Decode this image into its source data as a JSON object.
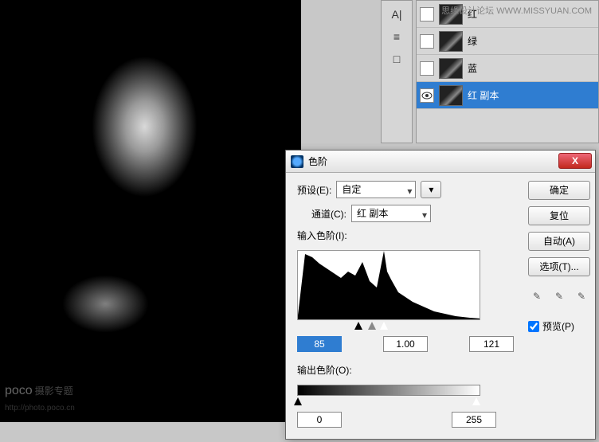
{
  "watermark": {
    "brand": "poco",
    "tag": "摄影专题",
    "url": "http://photo.poco.cn",
    "top": "思缘设计论坛   WWW.MISSYUAN.COM"
  },
  "sidebar": {
    "type_icon": "A|",
    "align_icon": "≡",
    "swatch_icon": "□"
  },
  "channels": {
    "items": [
      {
        "vis": "",
        "name": "红"
      },
      {
        "vis": "",
        "name": "绿"
      },
      {
        "vis": "",
        "name": "蓝"
      },
      {
        "vis": "eye",
        "name": "红 副本",
        "selected": true
      }
    ]
  },
  "dialog": {
    "title": "色阶",
    "preset_label": "预设(E):",
    "preset_value": "自定",
    "channel_label": "通道(C):",
    "channel_value": "红 副本",
    "input_label": "输入色阶(I):",
    "output_label": "输出色阶(O):",
    "input_vals": {
      "black": "85",
      "gamma": "1.00",
      "white": "121"
    },
    "output_vals": {
      "black": "0",
      "white": "255"
    },
    "buttons": {
      "ok": "确定",
      "cancel": "复位",
      "auto": "自动(A)",
      "options": "选项(T)..."
    },
    "preview": "预览(P)",
    "close": "X"
  },
  "chart_data": {
    "type": "area",
    "title": "输入色阶(I):",
    "xlabel": "",
    "ylabel": "",
    "x": [
      0,
      10,
      20,
      30,
      40,
      50,
      60,
      70,
      80,
      90,
      100,
      110,
      120,
      130,
      140,
      150,
      160,
      170,
      180,
      190,
      200,
      210,
      220,
      230,
      240,
      255
    ],
    "values": [
      5,
      82,
      78,
      70,
      64,
      58,
      52,
      60,
      55,
      72,
      48,
      40,
      86,
      50,
      34,
      28,
      22,
      18,
      14,
      10,
      8,
      6,
      4,
      3,
      2,
      1
    ],
    "xlim": [
      0,
      255
    ],
    "ylim": [
      0,
      88
    ],
    "sliders": {
      "black": 85,
      "gamma": 1.0,
      "white": 121
    }
  }
}
